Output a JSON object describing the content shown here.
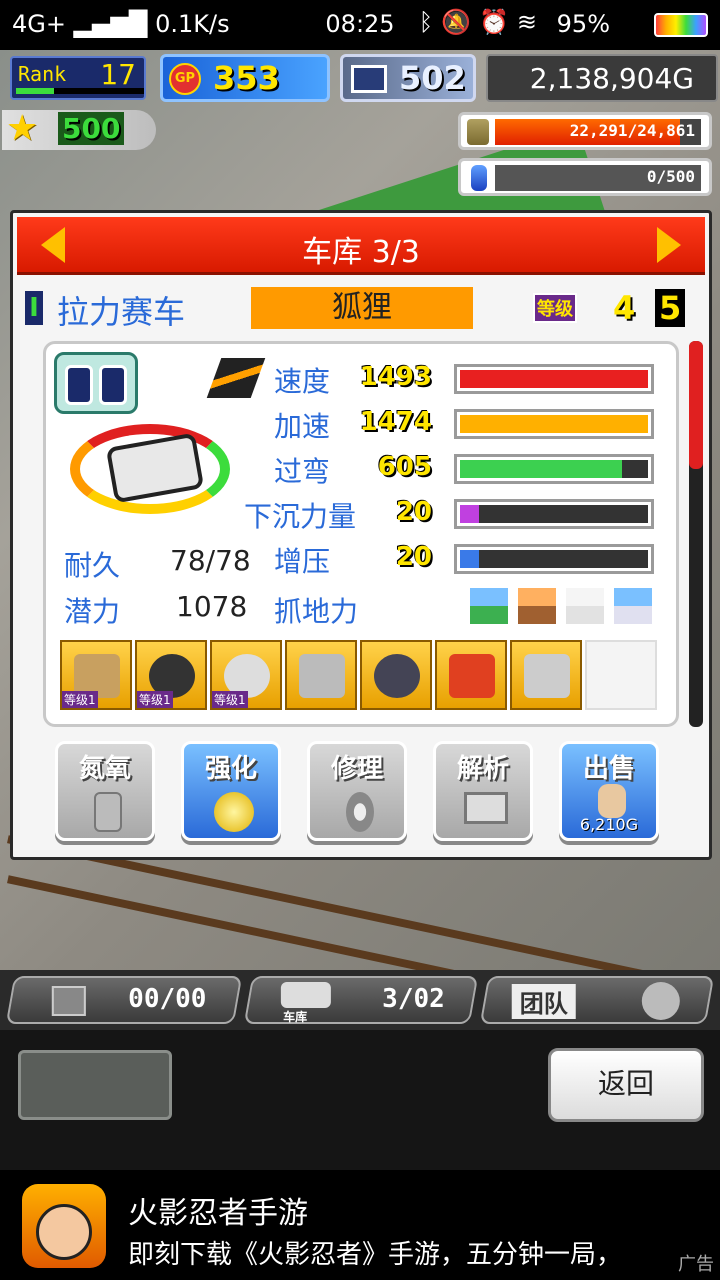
{
  "status_bar": {
    "network": "4G+",
    "speed": "0.1K/s",
    "time": "08:25",
    "battery": "95%",
    "icons": [
      "signal-icon",
      "bluetooth-icon",
      "mute-icon",
      "alarm-icon",
      "wifi-icon",
      "battery-icon"
    ]
  },
  "hud": {
    "rank_label": "Rank",
    "rank_value": "17",
    "rank_progress": 0.3,
    "gp_label": "GP",
    "gp_value": "353",
    "pc_value": "502",
    "money": "2,138,904G",
    "stars": "500",
    "fuel_text": "22,291/24,861",
    "fuel_ratio": 0.897,
    "water_text": "0/500",
    "water_ratio": 0.0
  },
  "panel": {
    "title": "车库 3/3",
    "car_class": "I",
    "car_category": "拉力赛车",
    "car_name": "狐狸",
    "level_badge": "等级",
    "level_current": "4",
    "level_max": "5"
  },
  "stats": [
    {
      "label": "速度",
      "value": "1493",
      "ratio": 1.0,
      "color": "#e82020"
    },
    {
      "label": "加速",
      "value": "1474",
      "ratio": 1.0,
      "color": "#ffb000"
    },
    {
      "label": "过弯",
      "value": "605",
      "ratio": 0.86,
      "color": "#3cd050"
    },
    {
      "label": "下沉力量",
      "value": "20",
      "ratio": 0.1,
      "color": "#c040e0"
    },
    {
      "label": "增压",
      "value": "20",
      "ratio": 0.1,
      "color": "#3a7ae8"
    }
  ],
  "durability": {
    "label": "耐久",
    "value": "78/78"
  },
  "potential": {
    "label": "潜力",
    "value": "1078"
  },
  "grip_label": "抓地力",
  "parts": [
    {
      "name": "engine",
      "level": "等级1"
    },
    {
      "name": "tire",
      "level": "等级1"
    },
    {
      "name": "brake",
      "level": "等级1"
    },
    {
      "name": "muffler",
      "level": ""
    },
    {
      "name": "chain",
      "level": ""
    },
    {
      "name": "oil",
      "level": ""
    },
    {
      "name": "frame",
      "level": ""
    },
    {
      "name": "empty",
      "level": ""
    }
  ],
  "actions": {
    "nitro": "氮氧",
    "upgrade": "强化",
    "repair": "修理",
    "analyze": "解析",
    "sell": "出售",
    "sell_price": "6,210G"
  },
  "bottom": {
    "seg1_value": "00/00",
    "garage_label": "车库",
    "garage_value": "3/02",
    "team_label": "团队",
    "back": "返回"
  },
  "ad": {
    "title": "火影忍者手游",
    "desc": "即刻下载《火影忍者》手游，五分钟一局，",
    "tag": "广告"
  }
}
